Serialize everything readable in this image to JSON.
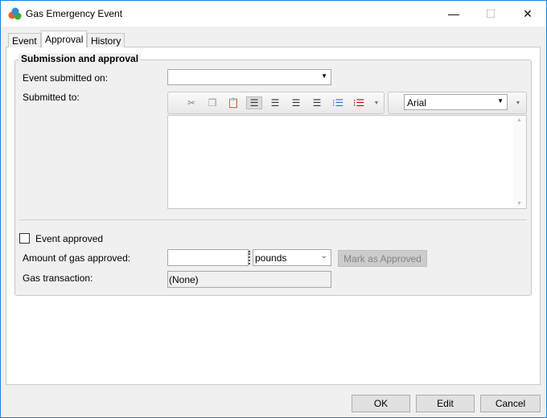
{
  "window": {
    "title": "Gas Emergency Event",
    "minimize": "—",
    "maximize": "☐",
    "close": "✕"
  },
  "tabs": [
    {
      "label": "Event"
    },
    {
      "label": "Approval"
    },
    {
      "label": "History"
    }
  ],
  "group": {
    "title": "Submission and approval"
  },
  "form": {
    "submitted_on_label": "Event submitted on:",
    "submitted_on_value": "",
    "submitted_to_label": "Submitted to:",
    "font_name": "Arial",
    "event_approved_label": "Event approved",
    "event_approved_checked": false,
    "amount_label": "Amount of gas approved:",
    "amount_value": "",
    "unit_value": "pounds",
    "mark_approved_label": "Mark as Approved",
    "transaction_label": "Gas transaction:",
    "transaction_value": "(None)"
  },
  "footer": {
    "ok": "OK",
    "edit": "Edit",
    "cancel": "Cancel"
  }
}
